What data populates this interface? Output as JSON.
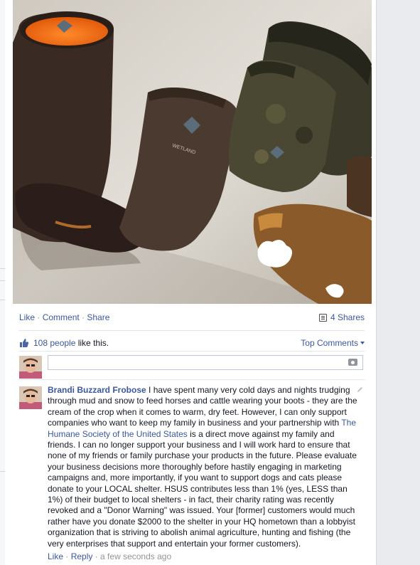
{
  "post": {
    "photo_alt_icon": "rubber-boots-photo",
    "actions": {
      "like": "Like",
      "comment": "Comment",
      "share": "Share",
      "sep": " · "
    },
    "shares": {
      "icon": "shares-icon",
      "label": "4 Shares"
    },
    "likes": {
      "icon": "thumbs-up-icon",
      "count_label": "108 people",
      "suffix": " like this."
    },
    "comments_sort": {
      "label": "Top Comments",
      "icon": "caret-down-icon"
    },
    "comment_input": {
      "placeholder": "",
      "attach_icon": "camera-icon"
    }
  },
  "comment": {
    "author": "Brandi Buzzard Frobose",
    "text_before_link": " I have spent many very cold days and nights trudging through mud and snow to feed horses and cattle wearing your boots - they are the cream of the crop when it comes to warm, dry feet. However, I can only support companies who want to keep my family in business and your partnership with ",
    "link": "The Humane Society of the United States",
    "text_after_link": " is a direct move against my family and friends. I can no longer support your business and I will work hard to ensure that none of my friends or family purchase your products in the future. Please evaluate your business decisions more thoroughly before hastily engaging in marketing campaigns and, more importantly, if you want to support dogs and cats please donate to your LOCAL shelter. HSUS contributes less than 1% (yes, LESS than 1%) of their budget to local shelters - in fact, their charity rating was recently revoked and a \"Donor Warning\" was issued. Your [former] customers would much rather have you donate $2000 to the shelter in your HQ hometown than a lobbyist organization that is striving to abolish animal agriculture, hunting and fishing (the very enterprises that support and entertain your former customers).",
    "like": "Like",
    "reply": "Reply",
    "sep": " · ",
    "time": "a few seconds ago",
    "edit_icon": "pencil-icon"
  },
  "colors": {
    "link": "#3b5998",
    "muted": "#90949c",
    "text": "#141823"
  }
}
